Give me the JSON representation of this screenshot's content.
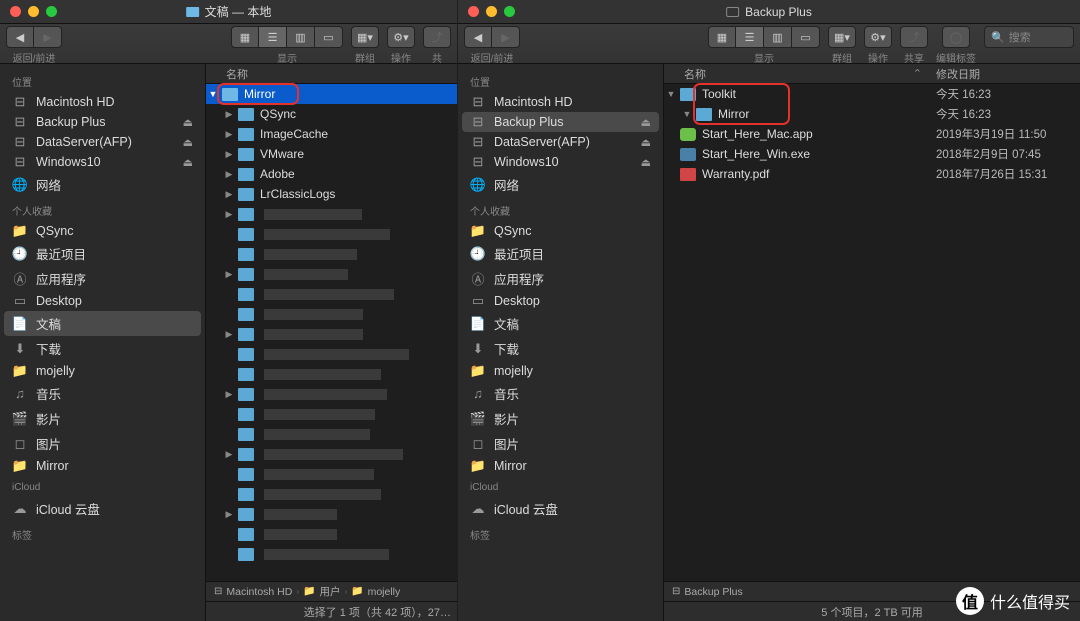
{
  "left": {
    "title": "文稿 — 本地",
    "toolbar": {
      "nav": "返回/前进",
      "view": "显示",
      "group": "群组",
      "action": "操作",
      "share": "共"
    },
    "sidebar": {
      "s1": "位置",
      "loc": [
        "Macintosh HD",
        "Backup Plus",
        "DataServer(AFP)",
        "Windows10",
        "网络"
      ],
      "s2": "个人收藏",
      "fav": [
        "QSync",
        "最近项目",
        "应用程序",
        "Desktop",
        "文稿",
        "下载",
        "mojelly",
        "音乐",
        "影片",
        "图片",
        "Mirror"
      ],
      "s3": "iCloud",
      "icloud": [
        "iCloud 云盘"
      ],
      "s4": "标签"
    },
    "cols": {
      "name": "名称"
    },
    "items": [
      {
        "n": "Mirror",
        "t": "folder",
        "sel": true,
        "exp": true
      },
      {
        "n": "QSync",
        "t": "folder",
        "child": true
      },
      {
        "n": "ImageCache",
        "t": "folder",
        "child": true
      },
      {
        "n": "VMware",
        "t": "folder",
        "child": true
      },
      {
        "n": "Adobe",
        "t": "folder",
        "child": true
      },
      {
        "n": "LrClassicLogs",
        "t": "folder",
        "child": true
      }
    ],
    "path": [
      "Macintosh HD",
      "用户",
      "mojelly"
    ],
    "status": "选择了 1 项（共 42 项），27…"
  },
  "right": {
    "title": "Backup Plus",
    "toolbar": {
      "nav": "返回/前进",
      "view": "显示",
      "group": "群组",
      "action": "操作",
      "share": "共享",
      "tags": "编辑标签",
      "search": "搜索"
    },
    "sidebar": {
      "s1": "位置",
      "loc": [
        "Macintosh HD",
        "Backup Plus",
        "DataServer(AFP)",
        "Windows10",
        "网络"
      ],
      "s2": "个人收藏",
      "fav": [
        "QSync",
        "最近项目",
        "应用程序",
        "Desktop",
        "文稿",
        "下载",
        "mojelly",
        "音乐",
        "影片",
        "图片",
        "Mirror"
      ],
      "s3": "iCloud",
      "icloud": [
        "iCloud 云盘"
      ],
      "s4": "标签"
    },
    "cols": {
      "name": "名称",
      "date": "修改日期"
    },
    "items": [
      {
        "n": "Toolkit",
        "t": "folder",
        "exp": true,
        "d": "今天 16:23"
      },
      {
        "n": "Mirror",
        "t": "folder",
        "child": true,
        "exp": true,
        "d": "今天 16:23"
      },
      {
        "n": "Start_Here_Mac.app",
        "t": "app",
        "d": "2019年3月19日 11:50"
      },
      {
        "n": "Start_Here_Win.exe",
        "t": "exe",
        "d": "2018年2月9日 07:45"
      },
      {
        "n": "Warranty.pdf",
        "t": "pdf",
        "d": "2018年7月26日 15:31"
      }
    ],
    "path": [
      "Backup Plus"
    ],
    "status": "5 个项目，2 TB 可用"
  },
  "watermark": "什么值得买",
  "watermark_badge": "值"
}
